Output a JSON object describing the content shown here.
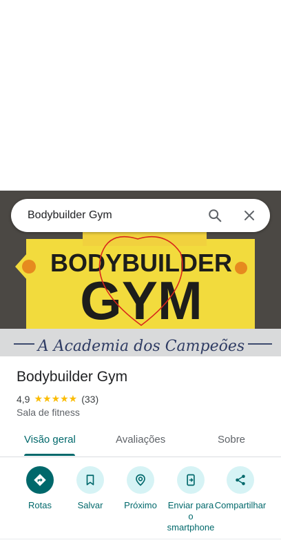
{
  "search": {
    "query": "Bodybuilder Gym"
  },
  "place": {
    "name": "Bodybuilder Gym",
    "rating": "4,9",
    "stars": "★★★★★",
    "review_count": "(33)",
    "category": "Sala de fitness"
  },
  "photo": {
    "logo_line1": "BODYBUILDER",
    "logo_line2": "GYM",
    "slogan": "A Academia dos Campeões"
  },
  "tabs": [
    {
      "label": "Visão geral",
      "active": true
    },
    {
      "label": "Avaliações",
      "active": false
    },
    {
      "label": "Sobre",
      "active": false
    }
  ],
  "actions": [
    {
      "label": "Rotas",
      "icon": "directions-icon"
    },
    {
      "label": "Salvar",
      "icon": "bookmark-icon"
    },
    {
      "label": "Próximo",
      "icon": "nearby-icon"
    },
    {
      "label": "Enviar para o smartphone",
      "icon": "send-to-phone-icon"
    },
    {
      "label": "Compartilhar",
      "icon": "share-icon"
    }
  ],
  "colors": {
    "accent": "#00686b",
    "accent_light": "#d6f3f5",
    "star": "#fbbc04"
  }
}
